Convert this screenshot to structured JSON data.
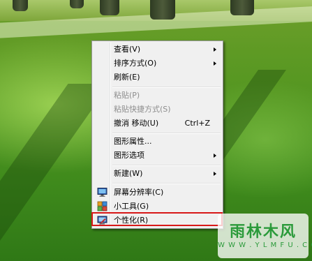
{
  "context_menu": {
    "items": [
      {
        "label": "查看(V)"
      },
      {
        "label": "排序方式(O)"
      },
      {
        "label": "刷新(E)"
      },
      {
        "label": "粘贴(P)"
      },
      {
        "label": "粘贴快捷方式(S)"
      },
      {
        "label": "撤消 移动(U)",
        "shortcut": "Ctrl+Z"
      },
      {
        "label": "图形属性..."
      },
      {
        "label": "图形选项"
      },
      {
        "label": "新建(W)"
      },
      {
        "label": "屏幕分辨率(C)",
        "icon": "monitor-icon"
      },
      {
        "label": "小工具(G)",
        "icon": "gadgets-icon"
      },
      {
        "label": "个性化(R)",
        "icon": "personalize-icon"
      }
    ]
  },
  "watermark": {
    "title": "雨林木风",
    "url": "W W W . Y L M F U . C O M"
  },
  "colors": {
    "menu_bg": "#f0f0f0",
    "highlight_border": "#d81818",
    "watermark_text": "#2a9a3a"
  }
}
